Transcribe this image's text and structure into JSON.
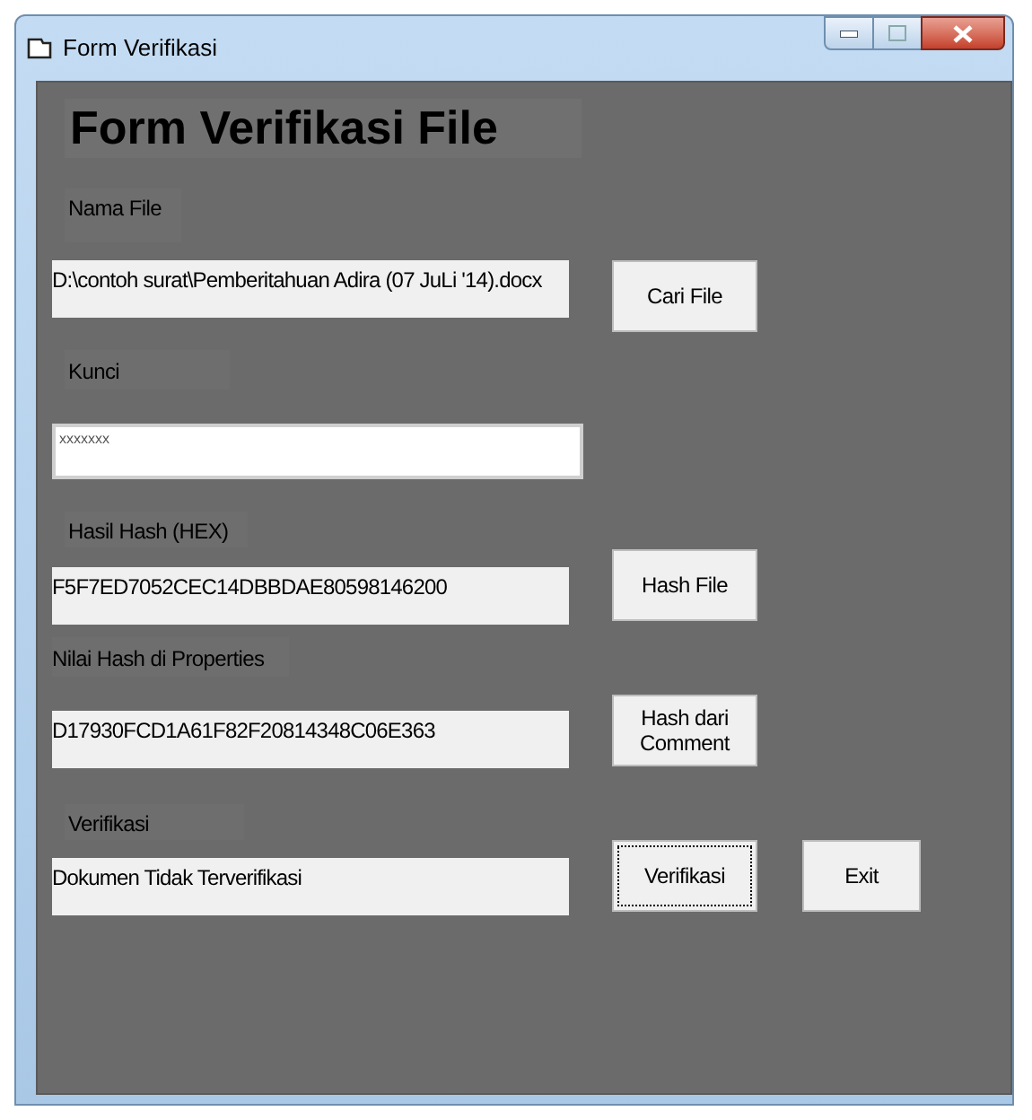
{
  "window": {
    "title": "Form Verifikasi"
  },
  "heading": "Form Verifikasi File",
  "rows": [
    {
      "label": "Nama File",
      "field": {
        "kind": "readonly",
        "value": "D:\\contoh surat\\Pemberitahuan Adira (07 JuLi '14).docx"
      },
      "buttons": [
        {
          "label": "Cari File",
          "focused": false
        }
      ]
    },
    {
      "label": "Kunci",
      "field": {
        "kind": "password",
        "value": "xxxxxxx"
      },
      "buttons": []
    },
    {
      "label": "Hasil Hash (HEX)",
      "field": {
        "kind": "readonly",
        "value": "F5F7ED7052CEC14DBBDAE80598146200"
      },
      "buttons": [
        {
          "label": "Hash File",
          "focused": false
        }
      ]
    },
    {
      "label": "Nilai Hash di Properties",
      "field": {
        "kind": "readonly",
        "value": "D17930FCD1A61F82F20814348C06E363"
      },
      "buttons": [
        {
          "label": "Hash dari Comment",
          "focused": false
        }
      ]
    },
    {
      "label": "Verifikasi",
      "field": {
        "kind": "readonly",
        "value": "Dokumen Tidak Terverifikasi"
      },
      "buttons": [
        {
          "label": "Verifikasi",
          "focused": true
        },
        {
          "label": "Exit",
          "focused": false
        }
      ]
    }
  ]
}
